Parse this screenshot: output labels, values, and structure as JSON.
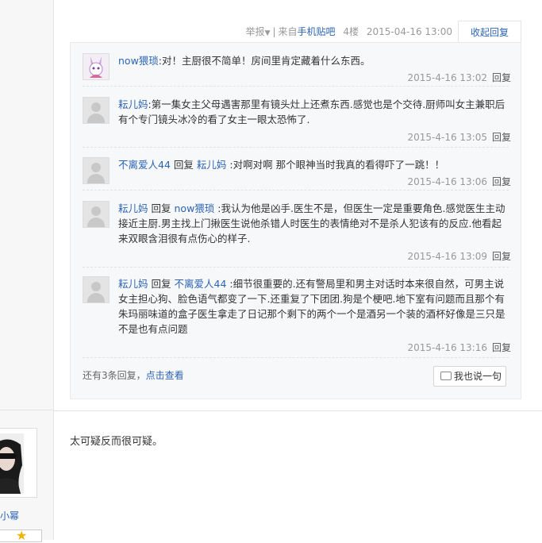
{
  "post_meta": {
    "report_label": "举报",
    "source_prefix": "来自",
    "source_link": "手机贴吧",
    "floor": "4楼",
    "datetime": "2015-04-16 13:00"
  },
  "collapse_reply_label": "收起回复",
  "replies": [
    {
      "user": "now猥琐",
      "reply_word": "",
      "target": "",
      "text": ":对！主厨很不简单！房间里肯定藏着什么东西。",
      "time": "2015-4-16 13:02",
      "reply_label": "回复"
    },
    {
      "user": "耘儿妈",
      "reply_word": "",
      "target": "",
      "text": ":第一集女主父母遇害那里有镜头灶上还煮东西.感觉也是个交待.厨师叫女主兼职后有个专门镜头冰冷的看了女主一眼太恐怖了.",
      "time": "2015-4-16 13:05",
      "reply_label": "回复"
    },
    {
      "user": "不离爱人44",
      "reply_word": "回复",
      "target": "耘儿妈",
      "text": ":对啊对啊 那个眼神当时我真的看得吓了一跳！！",
      "time": "2015-4-16 13:06",
      "reply_label": "回复"
    },
    {
      "user": "耘儿妈",
      "reply_word": "回复",
      "target": "now猥琐",
      "text": ":我认为他是凶手.医生不是，但医生一定是重要角色.感觉医生主动接近主厨.男主找上门揪医生说他杀错人时医生的表情绝对不是杀人犯该有的反应.他看起来双眼含泪很有点伤心的样子.",
      "time": "2015-4-16 13:09",
      "reply_label": "回复"
    },
    {
      "user": "耘儿妈",
      "reply_word": "回复",
      "target": "不离爱人44",
      "text": ":细节很重要的.还有警局里和男主对话时本来很自然，可男主说女主担心狗、脸色语气都变了一下.还重复了下团团.狗是个梗吧.地下室有问题而且那个有朱玛丽味道的盒子医生拿走了日记那个剩下的两个一个是酒另一个装的酒杯好像是三只是不是也有点问题",
      "time": "2015-4-16 13:16",
      "reply_label": "回复"
    }
  ],
  "more_replies": {
    "prefix": "还有3条回复，",
    "link": "点击查看"
  },
  "say_button_label": "我也说一句",
  "next_post": {
    "username": "小幂",
    "content": "太可疑反而很可疑。"
  },
  "icons": [
    "dropdown-caret-icon",
    "speech-bubble-icon",
    "default-avatar-icon",
    "rabbit-avatar-icon",
    "star-badge-icon"
  ]
}
